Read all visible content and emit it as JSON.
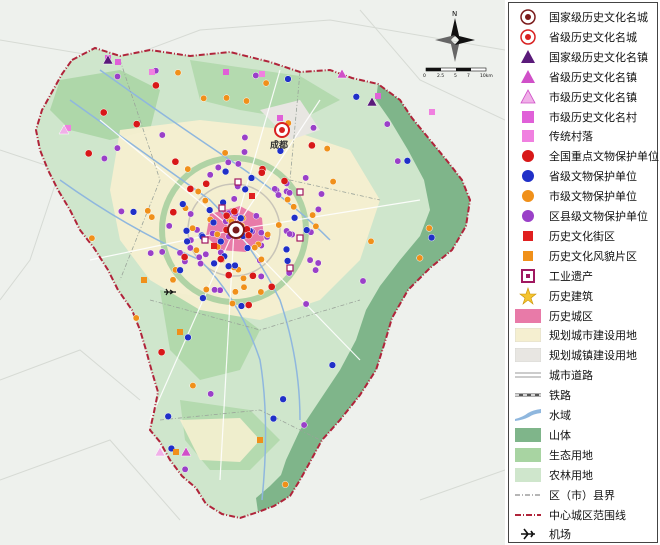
{
  "map": {
    "center_label": "成都",
    "north_label": "N",
    "scale_ticks": [
      "0",
      "2.5",
      "5",
      "7",
      "10km"
    ],
    "colors": {
      "mountain": "#7fb58a",
      "ecological": "#a8d4a2",
      "farmland": "#cfe6cc",
      "urban_planned": "#f5efd0",
      "town_planned": "#e8e6e2",
      "historic_area": "#e87aa8",
      "boundary": "#b0243a",
      "water": "#8fb7de",
      "outside": "#f0f2ef"
    }
  },
  "legend": {
    "items": [
      {
        "label": "国家级历史文化名城",
        "icon": "national-historic-city-icon"
      },
      {
        "label": "省级历史文化名城",
        "icon": "provincial-historic-city-icon"
      },
      {
        "label": "国家级历史文化名镇",
        "icon": "national-historic-town-icon"
      },
      {
        "label": "省级历史文化名镇",
        "icon": "provincial-historic-town-icon"
      },
      {
        "label": "市级历史文化名镇",
        "icon": "municipal-historic-town-icon"
      },
      {
        "label": "市级历史文化名村",
        "icon": "municipal-historic-village-icon"
      },
      {
        "label": "传统村落",
        "icon": "traditional-village-icon"
      },
      {
        "label": "全国重点文物保护单位",
        "icon": "national-relic-icon"
      },
      {
        "label": "省级文物保护单位",
        "icon": "provincial-relic-icon"
      },
      {
        "label": "市级文物保护单位",
        "icon": "municipal-relic-icon"
      },
      {
        "label": "区县级文物保护单位",
        "icon": "district-relic-icon"
      },
      {
        "label": "历史文化街区",
        "icon": "historic-block-icon"
      },
      {
        "label": "历史文化风貌片区",
        "icon": "historic-area-icon"
      },
      {
        "label": "工业遗产",
        "icon": "industrial-heritage-icon"
      },
      {
        "label": "历史建筑",
        "icon": "historic-building-star-icon"
      },
      {
        "label": "历史城区",
        "icon": "historic-district-swatch-icon"
      },
      {
        "label": "规划城市建设用地",
        "icon": "urban-land-swatch-icon"
      },
      {
        "label": "规划城镇建设用地",
        "icon": "town-land-swatch-icon"
      },
      {
        "label": "城市道路",
        "icon": "road-icon"
      },
      {
        "label": "铁路",
        "icon": "railway-icon"
      },
      {
        "label": "水域",
        "icon": "water-icon"
      },
      {
        "label": "山体",
        "icon": "mountain-swatch-icon"
      },
      {
        "label": "生态用地",
        "icon": "ecological-swatch-icon"
      },
      {
        "label": "农林用地",
        "icon": "farmland-swatch-icon"
      },
      {
        "label": "区（市）县界",
        "icon": "county-boundary-icon"
      },
      {
        "label": "中心城区范围线",
        "icon": "central-boundary-icon"
      },
      {
        "label": "机场",
        "icon": "airport-icon"
      }
    ]
  }
}
